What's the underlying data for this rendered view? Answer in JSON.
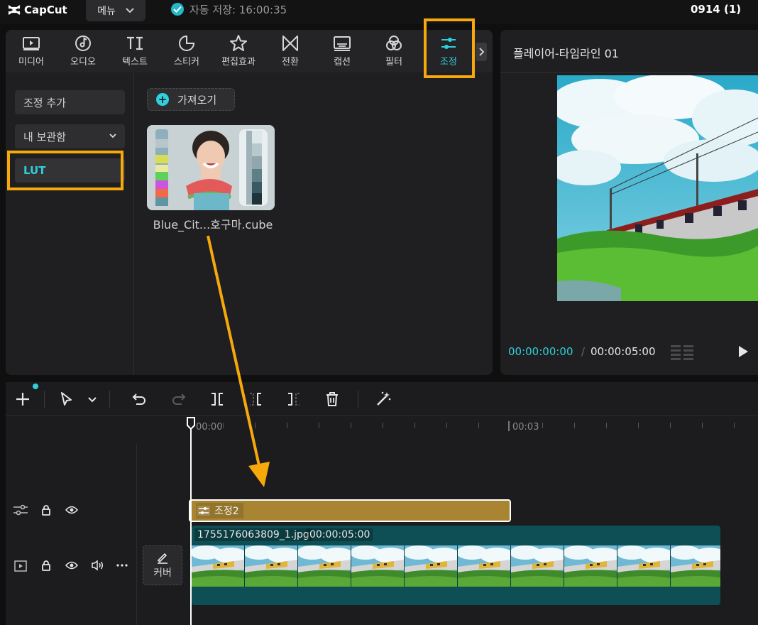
{
  "app": {
    "name": "CapCut",
    "menu_label": "메뉴",
    "autosave_text": "자동 저장: 16:00:35",
    "project_name": "0914 (1)"
  },
  "toolbar": {
    "tabs": [
      {
        "label": "미디어",
        "icon": "media-icon"
      },
      {
        "label": "오디오",
        "icon": "audio-icon"
      },
      {
        "label": "텍스트",
        "icon": "text-icon"
      },
      {
        "label": "스티커",
        "icon": "sticker-icon"
      },
      {
        "label": "편집효과",
        "icon": "effects-icon"
      },
      {
        "label": "전환",
        "icon": "transition-icon"
      },
      {
        "label": "캡션",
        "icon": "caption-icon"
      },
      {
        "label": "필터",
        "icon": "filter-icon"
      },
      {
        "label": "조정",
        "icon": "adjust-icon",
        "active": true
      }
    ]
  },
  "sidebar": {
    "items": [
      {
        "label": "조정 추가"
      },
      {
        "label": "내 보관함"
      },
      {
        "label": "LUT",
        "selected": true
      }
    ]
  },
  "content": {
    "import_label": "가져오기",
    "lut_file": "Blue_Cit...호구마.cube"
  },
  "player": {
    "title": "플레이어-타임라인 01",
    "time_current": "00:00:00:00",
    "time_separator": "/",
    "time_total": "00:00:05:00"
  },
  "timeline": {
    "ruler_labels": [
      "00:00",
      "00:03"
    ],
    "adjust_clip_label": "조정2",
    "video_clip_name": "1755176063809_1.jpg",
    "video_clip_duration": "00:00:05:00",
    "cover_label": "커버"
  },
  "colors": {
    "accent": "#2fd0dc",
    "highlight": "#f7a90c",
    "adjust_clip": "#a88433",
    "video_clip": "#0e4f55"
  }
}
